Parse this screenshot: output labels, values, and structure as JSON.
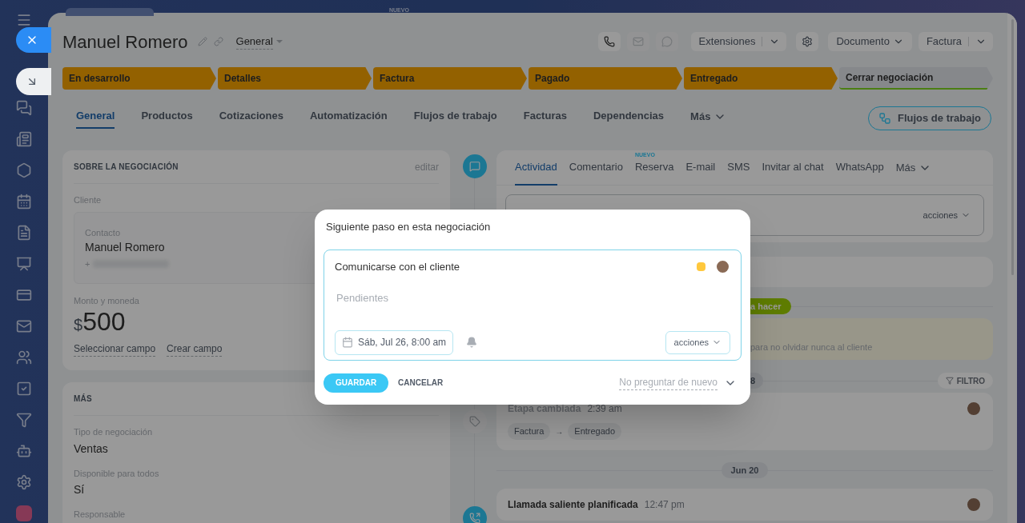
{
  "top_bar": {
    "badge": "NUEVO"
  },
  "header": {
    "title": "Manuel Romero",
    "category": "General",
    "buttons": [
      {
        "label": "Extensiones",
        "kind": "split"
      },
      {
        "label": "Documento",
        "kind": "dropdown"
      },
      {
        "label": "Factura",
        "kind": "split"
      }
    ]
  },
  "stages": [
    {
      "label": "En desarrollo",
      "reached": true
    },
    {
      "label": "Detalles",
      "reached": true
    },
    {
      "label": "Factura",
      "reached": true
    },
    {
      "label": "Pagado",
      "reached": true
    },
    {
      "label": "Entregado",
      "reached": true
    },
    {
      "label": "Cerrar negociación",
      "reached": false
    }
  ],
  "tabs": [
    {
      "label": "General",
      "selected": true
    },
    {
      "label": "Productos",
      "selected": false
    },
    {
      "label": "Cotizaciones",
      "selected": false
    },
    {
      "label": "Automatización",
      "selected": false
    },
    {
      "label": "Flujos de trabajo",
      "selected": false
    },
    {
      "label": "Facturas",
      "selected": false
    },
    {
      "label": "Dependencias",
      "selected": false
    }
  ],
  "tabs_more": "Más",
  "workflow_button": "Flujos de trabajo",
  "about": {
    "title": "SOBRE LA NEGOCIACIÓN",
    "edit": "editar",
    "client_label": "Cliente",
    "contact_label": "Contacto",
    "contact_name": "Manuel Romero",
    "phone_prefix": "+",
    "amount_label": "Monto y moneda",
    "currency": "$",
    "amount": "500",
    "links": [
      "Seleccionar campo",
      "Crear campo"
    ]
  },
  "more_section": {
    "title": "MÁS",
    "fields": [
      {
        "label": "Tipo de negociación",
        "value": "Ventas"
      },
      {
        "label": "Disponible para todos",
        "value": "Sí"
      },
      {
        "label": "Responsable"
      }
    ]
  },
  "activity": {
    "tabs": [
      {
        "label": "Actividad",
        "selected": true
      },
      {
        "label": "Comentario",
        "selected": false
      },
      {
        "label": "Reserva",
        "selected": false,
        "badge": "NUEVO"
      },
      {
        "label": "E-mail",
        "selected": false
      },
      {
        "label": "SMS",
        "selected": false
      },
      {
        "label": "Invitar al chat",
        "selected": false
      },
      {
        "label": "WhatsApp",
        "selected": false
      }
    ],
    "more": "Más",
    "composer_actions": "acciones",
    "todo_badge": "a hacer",
    "hint": "para no olvidar nunca al cliente",
    "date_badge": "8",
    "filter": "FILTRO",
    "events": [
      {
        "kind": "stage",
        "title": "Etapa cambiada",
        "time": "2:39 am",
        "from": "Factura",
        "arrow": "→",
        "to": "Entregado"
      },
      {
        "kind": "call",
        "title": "Llamada saliente planificada",
        "time": "12:47 pm",
        "divider": "Jun 20"
      }
    ]
  },
  "dialog": {
    "title": "Siguiente paso en esta negociación",
    "subject": "Comunicarse con el cliente",
    "placeholder": "Pendientes",
    "date": "Sáb, Jul 26, 8:00 am",
    "actions": "acciones",
    "save": "GUARDAR",
    "cancel": "CANCELAR",
    "dont_ask": "No preguntar de nuevo"
  }
}
